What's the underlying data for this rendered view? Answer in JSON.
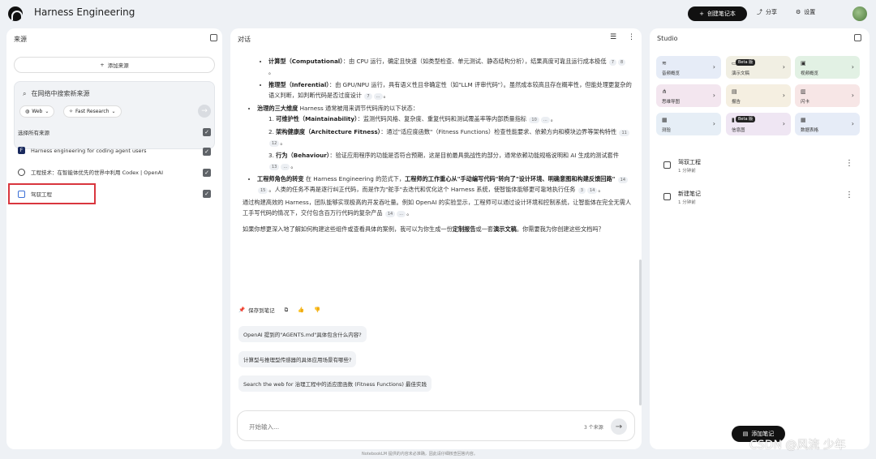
{
  "app": {
    "title": "Harness Engineering",
    "create_label": "创建笔记本",
    "share_label": "分享",
    "settings_label": "设置"
  },
  "sources": {
    "title": "来源",
    "add_label": "添加来源",
    "search_placeholder": "在网络中搜索新来源",
    "web_chip": "Web",
    "research_chip": "Fast Research",
    "select_all_label": "选择所有来源",
    "items": [
      {
        "label": "Harness engineering for coding agent users"
      },
      {
        "label": "工程技术：在智能体优先的世界中利用 Codex | OpenAI"
      },
      {
        "label": "驾驭工程"
      }
    ]
  },
  "chat": {
    "title": "对话",
    "b1_title": "计算型（Computational）",
    "b1_text": "：由 CPU 运行，确定且快速（如类型检查、单元测试、静态结构分析），结果高度可靠且运行成本极低",
    "b1_c1": "7",
    "b1_c2": "8",
    "b2_title": "推理型（Inferential）",
    "b2_text": "：由 GPU/NPU 运行，具有语义性且非确定性（如\"LLM 评审代码\"）。虽然成本较高且存在概率性，但能处理更复杂的语义判断，如判断代码是否过度设计",
    "b2_c1": "7",
    "b2_c2": "…",
    "main2_title": "治理的三大维度",
    "main2_text": " Harness 通常被用来调节代码库的以下状态：",
    "s1_title": "可维护性（Maintainability）",
    "s1_text": "：监测代码风格、复杂度、重复代码和测试覆盖率等内部质量指标",
    "s1_c1": "10",
    "s1_c2": "…",
    "s2_title": "架构健康度（Architecture Fitness）",
    "s2_text": "：通过\"适应度函数\"（Fitness Functions）检查性能要求、依赖方向和模块边界等架构特性",
    "s2_c1": "11",
    "s2_c2": "12",
    "s3_title": "行为（Behaviour）",
    "s3_text": "：验证应用程序的功能是否符合预期，这是目前最具挑战性的部分，通常依赖功能规格说明和 AI 生成的测试套件",
    "s3_c1": "13",
    "s3_c2": "…",
    "main3_title1": "工程师角色的转变",
    "main3_text1": " 在 Harness Engineering 的范式下，",
    "main3_title2": "工程师的工作重心从\"手动编写代码\"转向了\"设计环境、明确意图和构建反馈回路\"",
    "main3_c1": "14",
    "main3_c2": "15",
    "main3_text2": "。人类的任务不再是逐行纠正代码，而是作为\"舵手\"去迭代和优化这个 Harness 系统，使智能体能够更可靠地执行任务",
    "main3_c3": "3",
    "main3_c4": "14",
    "para1": "通过构建高效的 Harness，团队能够实现极高的开发吞吐量。例如 OpenAI 的实验显示，工程师可以通过设计环境和控制系统，让智能体在完全无需人工手写代码的情况下，交付包含百万行代码的复杂产品",
    "para1_c1": "14",
    "para1_c2": "…",
    "para2_pre": "如果你想更深入地了解如何构建这些组件或查看具体的案例，我可以为你生成一份",
    "para2_b1": "定制报告",
    "para2_mid": "或一套",
    "para2_b2": "演示文稿",
    "para2_post": "。你需要我为你创建这些文档吗？",
    "save_note_label": "保存到笔记",
    "suggestions": [
      "OpenAI 提到的\"AGENTS.md\"具体包含什么内容?",
      "计算型与推理型传感器的具体应用场景有哪些?",
      "Search the web for 治理工程中的适应度函数 (Fitness Functions) 最佳实践"
    ],
    "input_placeholder": "开始输入...",
    "source_count": "3 个来源",
    "footer": "NotebookLM 提供的内容未必准确，因此请仔细核查回答内容。"
  },
  "studio": {
    "title": "Studio",
    "tiles": [
      {
        "label": "音频概览",
        "color": "#e6ecf7"
      },
      {
        "label": "演示文稿",
        "color": "#f1efe3",
        "beta": "Beta 版"
      },
      {
        "label": "视频概览",
        "color": "#e2f1e4"
      },
      {
        "label": "思维导图",
        "color": "#f3e6ef"
      },
      {
        "label": "报告",
        "color": "#f5efe1"
      },
      {
        "label": "闪卡",
        "color": "#f7e6e6"
      },
      {
        "label": "测验",
        "color": "#e6eef6"
      },
      {
        "label": "信息图",
        "color": "#efe6f3",
        "beta": "Beta 版"
      },
      {
        "label": "数据表格",
        "color": "#e6ecf7"
      }
    ],
    "notes": [
      {
        "title": "驾驭工程",
        "time": "1 分钟前"
      },
      {
        "title": "新建笔记",
        "time": "1 分钟前"
      }
    ],
    "add_note_label": "添加笔记"
  },
  "watermark": "CSDN @风流 少年"
}
